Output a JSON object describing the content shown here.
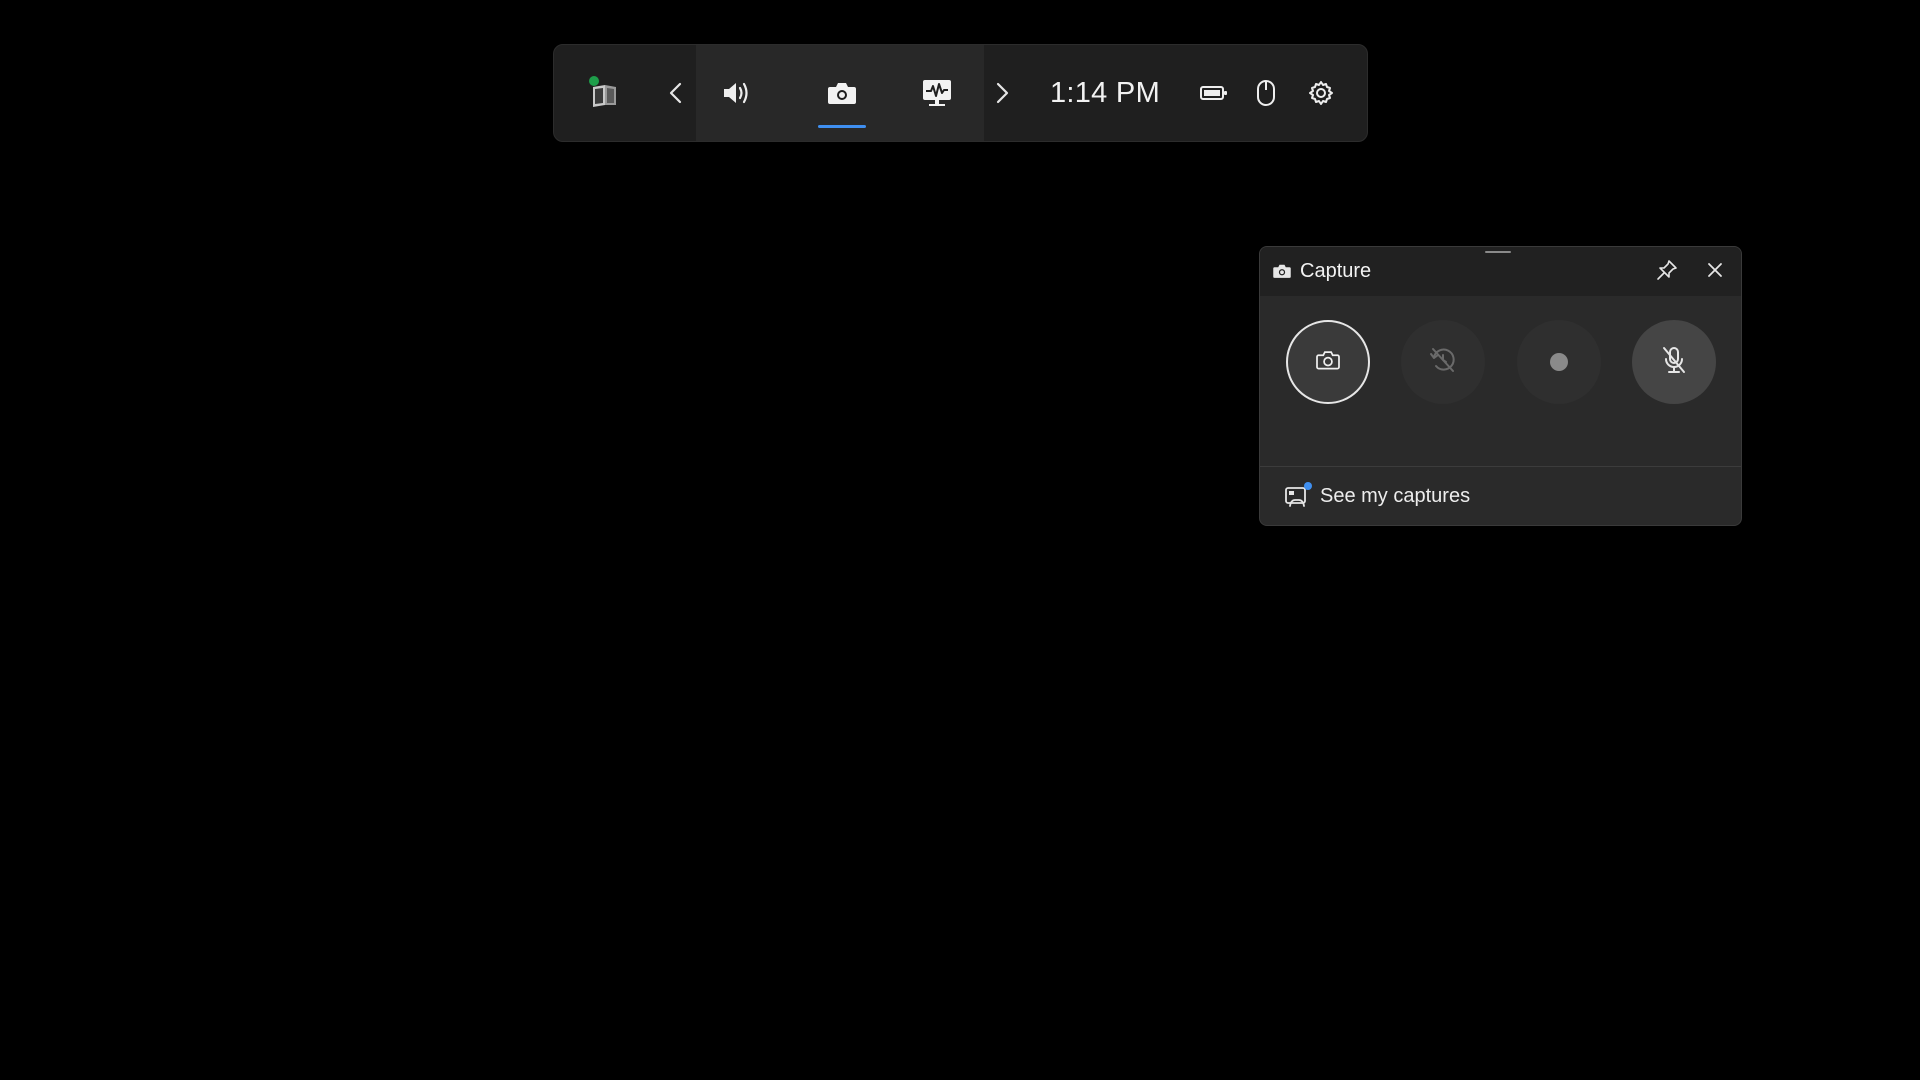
{
  "topbar": {
    "time": "1:14 PM",
    "accent_color": "#3f8ff0",
    "status_dot_color": "#1e9e4a",
    "icons": {
      "widgets": "widget-menu-icon",
      "prev": "chevron-left-icon",
      "audio": "speaker-icon",
      "capture": "camera-icon",
      "performance": "performance-monitor-icon",
      "next": "chevron-right-icon",
      "battery": "battery-icon",
      "mouse": "mouse-icon",
      "settings": "gear-icon"
    }
  },
  "capture_widget": {
    "title": "Capture",
    "icons": {
      "header": "camera-icon",
      "pin": "pin-icon",
      "close": "close-icon",
      "screenshot": "camera-icon",
      "record_last": "record-last-disabled-icon",
      "record": "record-dot-icon",
      "mic": "mic-off-icon",
      "captures_link": "gallery-icon"
    },
    "see_captures_label": "See my captures"
  }
}
